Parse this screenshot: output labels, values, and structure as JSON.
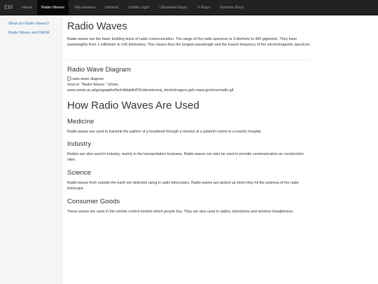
{
  "navbar": {
    "brand": "EM",
    "items": [
      {
        "label": "Home"
      },
      {
        "label": "Radio Waves"
      },
      {
        "label": "Microwaves"
      },
      {
        "label": "Infrared"
      },
      {
        "label": "Visible Light"
      },
      {
        "label": "Ultraviolet Rays"
      },
      {
        "label": "X-Rays"
      },
      {
        "label": "Gamma Rays"
      }
    ],
    "active_index": 1
  },
  "sidebar": {
    "links": [
      {
        "label": "What are Radio Waves?"
      },
      {
        "label": "Radio Waves and NASA"
      }
    ]
  },
  "main": {
    "title": "Radio Waves",
    "intro": "Radio waves are the basic building block of radio communication. The range of the radio spectrum is 3 kilohertz to 300 gigahertz. They have wavelengths from 1 millimeter to 100 kilometers. This means they the longest wavelength and the lowest frequency of the electromagnetic spectrum.",
    "diagram_heading": "Radio Wave Diagram",
    "image_alt": "radio wave diagram",
    "source_line1": "Source: \"Radio Waves.\" Univie,",
    "source_line2": "www.univie.ac.at/geographie/fachdidaktik/FD/site/external_htmls/imagers.gsfc.nasa.gov/ems/radio.gif.",
    "uses_heading": "How Radio Waves Are Used",
    "uses": [
      {
        "heading": "Medicine",
        "text": "Radio waves are used to transmit the pattern of a heartbeat through a monitor at a patient's home to a nearby hospital."
      },
      {
        "heading": "Industry",
        "text": "Radios are also used in industry, mainly in the transportation business. Radio waves can also be used to provide communication on construction sites."
      },
      {
        "heading": "Science",
        "text": "Radio waves from outside the earth are detected using in radio telescopes. Radio waves are picked up when they hit the antenna of the radio telescope."
      },
      {
        "heading": "Consumer Goods",
        "text": "These waves are used in the remote control models which people buy. They are also used in radios, televisions and wireless headphones."
      }
    ]
  }
}
